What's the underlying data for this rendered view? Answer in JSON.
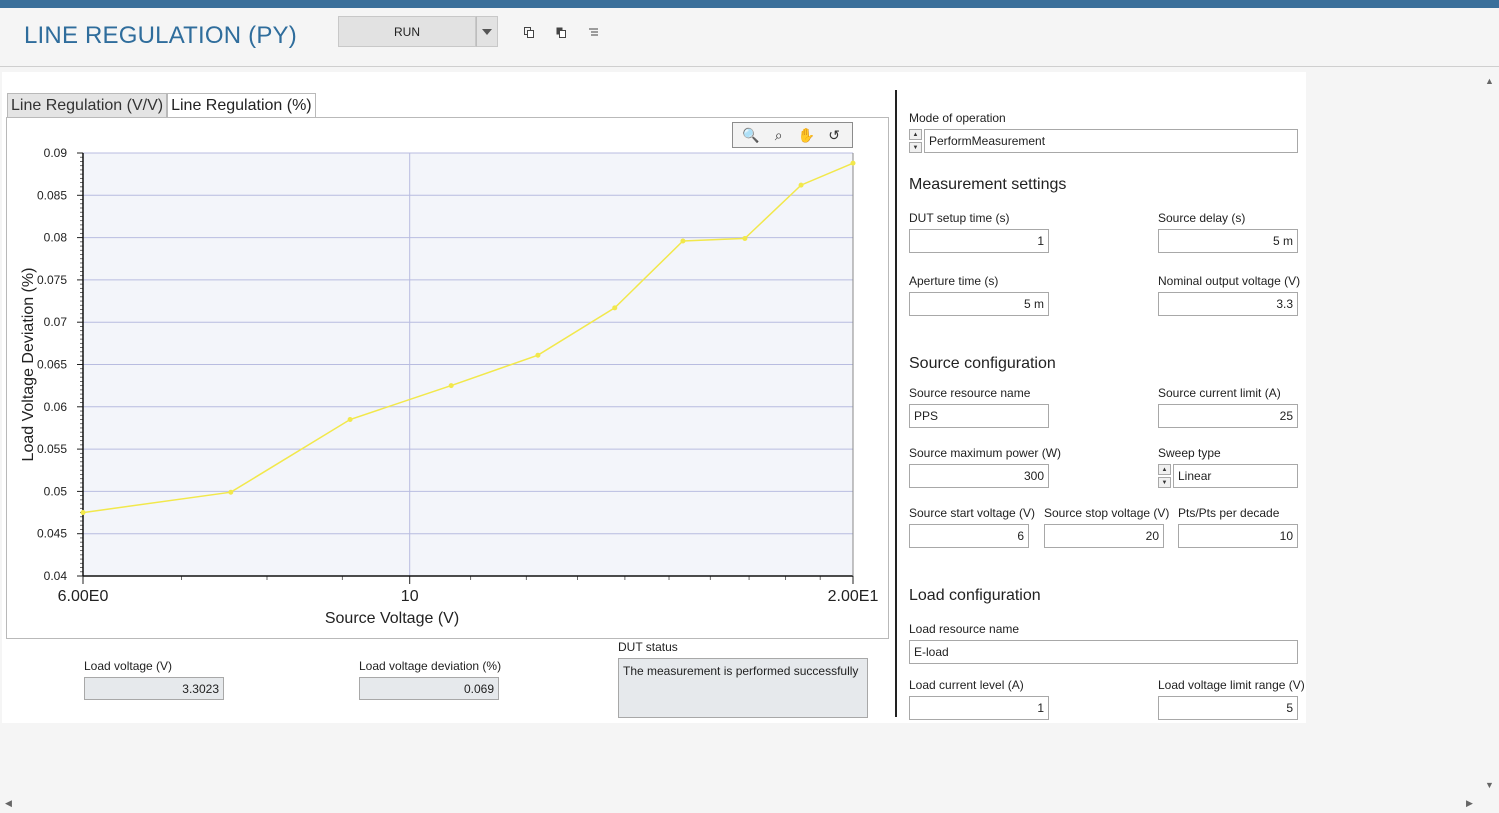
{
  "app": {
    "title": "LINE REGULATION (PY)"
  },
  "toolbar": {
    "run_label": "RUN",
    "dropdown_icon": "chevron-down-icon",
    "icons": [
      "copy-icon",
      "paste-icon",
      "list-icon"
    ]
  },
  "tabs": [
    {
      "label": "Line Regulation (V/V)",
      "active": false
    },
    {
      "label": "Line Regulation (%)",
      "active": true
    }
  ],
  "chart_toolbar": {
    "icons": [
      "zoom-icon",
      "zoom-region-icon",
      "pan-hand-icon",
      "reset-icon"
    ]
  },
  "chart_data": {
    "type": "line",
    "xlabel": "Source Voltage (V)",
    "ylabel": "Load Voltage Deviation (%)",
    "x_scale": "log",
    "xlim": [
      6,
      20
    ],
    "ylim": [
      0.04,
      0.09
    ],
    "x_tick_labels": [
      "6.00E0",
      "10",
      "2.00E1"
    ],
    "y_tick_labels": [
      "0.04",
      "0.045",
      "0.05",
      "0.055",
      "0.06",
      "0.065",
      "0.07",
      "0.075",
      "0.08",
      "0.085",
      "0.09"
    ],
    "grid": true,
    "series": [
      {
        "color": "#f2e84b",
        "x": [
          6.0,
          7.56,
          9.11,
          10.67,
          12.22,
          13.78,
          15.33,
          16.89,
          18.44,
          20.0
        ],
        "y": [
          0.0475,
          0.0499,
          0.0585,
          0.0625,
          0.0661,
          0.0717,
          0.0796,
          0.0799,
          0.0862,
          0.0888
        ]
      }
    ]
  },
  "readouts": {
    "load_voltage_label": "Load voltage (V)",
    "load_voltage_value": "3.3023",
    "load_dev_label": "Load voltage deviation (%)",
    "load_dev_value": "0.069",
    "dut_status_label": "DUT status",
    "dut_status_value": "The measurement is performed successfully"
  },
  "settings": {
    "mode_label": "Mode of operation",
    "mode_value": "PerformMeasurement",
    "measurement_title": "Measurement settings",
    "dut_setup_label": "DUT setup time (s)",
    "dut_setup_value": "1",
    "source_delay_label": "Source delay (s)",
    "source_delay_value": "5 m",
    "aperture_label": "Aperture time (s)",
    "aperture_value": "5 m",
    "nominal_label": "Nominal output voltage (V)",
    "nominal_value": "3.3",
    "source_title": "Source configuration",
    "source_resource_label": "Source resource name",
    "source_resource_value": "PPS",
    "source_current_label": "Source current limit (A)",
    "source_current_value": "25",
    "source_power_label": "Source maximum power (W)",
    "source_power_value": "300",
    "sweep_label": "Sweep type",
    "sweep_value": "Linear",
    "start_v_label": "Source start voltage (V)",
    "start_v_value": "6",
    "stop_v_label": "Source stop voltage (V)",
    "stop_v_value": "20",
    "pts_label": "Pts/Pts per decade",
    "pts_value": "10",
    "load_title": "Load configuration",
    "load_resource_label": "Load resource name",
    "load_resource_value": "E-load",
    "load_current_label": "Load current level (A)",
    "load_current_value": "1",
    "load_vlimit_label": "Load voltage limit range (V)",
    "load_vlimit_value": "5"
  },
  "colors": {
    "accent": "#2f6d9c",
    "topbar": "#3a6f9a",
    "series": "#f2e84b",
    "plot_bg": "#f3f5fa",
    "grid": "#b8bce0"
  }
}
